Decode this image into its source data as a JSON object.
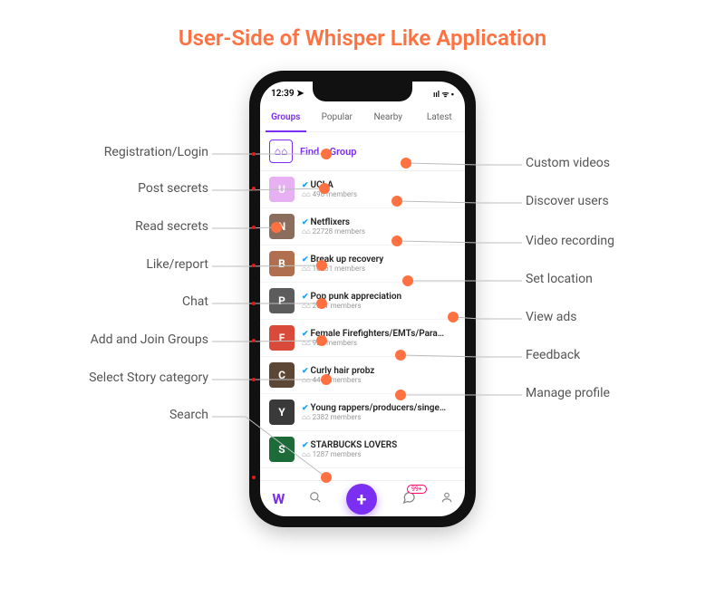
{
  "title": "User-Side of Whisper Like Application",
  "title_color": "#ff7141",
  "accent": "#7b2ff2",
  "statusbar": {
    "time": "12:39",
    "icons": "ııl ᯤ ▪"
  },
  "tabs": [
    {
      "label": "Groups",
      "active": true
    },
    {
      "label": "Popular",
      "active": false
    },
    {
      "label": "Nearby",
      "active": false
    },
    {
      "label": "Latest",
      "active": false
    }
  ],
  "find_a_group": "Find a Group",
  "groups": [
    {
      "name": "UCLA",
      "members": "498 members",
      "color": "#e6b0f2",
      "initial": "U"
    },
    {
      "name": "Netflixers",
      "members": "22728 members",
      "color": "#8a6d5c",
      "initial": "N"
    },
    {
      "name": "Break up recovery",
      "members": "10261 members",
      "color": "#b07050",
      "initial": "B"
    },
    {
      "name": "Pop punk appreciation",
      "members": "2641 members",
      "color": "#5c5c5c",
      "initial": "P"
    },
    {
      "name": "Female Firefighters/EMTs/Paramed...",
      "members": "921 members",
      "color": "#d94a3a",
      "initial": "F"
    },
    {
      "name": "Curly hair probz",
      "members": "4460 members",
      "color": "#5c4636",
      "initial": "C"
    },
    {
      "name": "Young rappers/producers/singers",
      "members": "2382 members",
      "color": "#3a3a3a",
      "initial": "Y"
    },
    {
      "name": "STARBUCKS LOVERS",
      "members": "1287 members",
      "color": "#1e6b3a",
      "initial": "S"
    }
  ],
  "bottom_badge": "99+",
  "left_features": [
    "Registration/Login",
    "Post secrets",
    "Read secrets",
    "Like/report",
    "Chat",
    "Add and Join Groups",
    "Select Story category",
    "Search"
  ],
  "right_features": [
    "Custom videos",
    "Discover users",
    "Video recording",
    "Set location",
    "View ads",
    "Feedback",
    "Manage profile"
  ]
}
